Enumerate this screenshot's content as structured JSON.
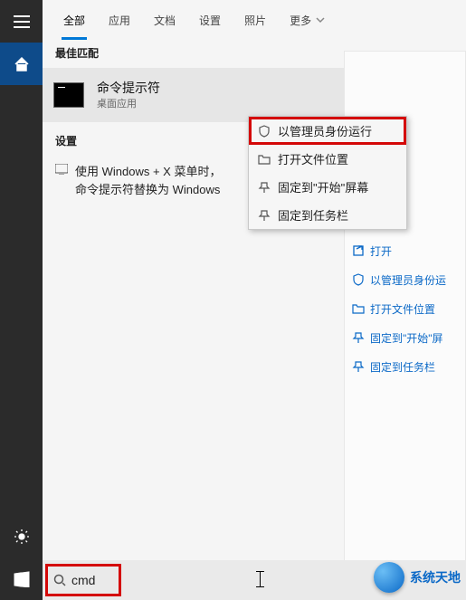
{
  "tabs": {
    "all": "全部",
    "apps": "应用",
    "docs": "文档",
    "settings": "设置",
    "photos": "照片",
    "more": "更多"
  },
  "sections": {
    "best_match": "最佳匹配",
    "settings": "设置"
  },
  "best_match": {
    "title": "命令提示符",
    "subtitle": "桌面应用"
  },
  "settings_result": {
    "line1": "使用 Windows + X 菜单时，",
    "line2": "命令提示符替换为 Windows"
  },
  "context_menu": {
    "run_admin": "以管理员身份运行",
    "open_location": "打开文件位置",
    "pin_start": "固定到\"开始\"屏幕",
    "pin_taskbar": "固定到任务栏"
  },
  "right_panel": {
    "open": "打开",
    "run_admin": "以管理员身份运",
    "open_location": "打开文件位置",
    "pin_start": "固定到\"开始\"屏",
    "pin_taskbar": "固定到任务栏"
  },
  "search": {
    "value": "cmd"
  },
  "brand": "系统天地",
  "colors": {
    "accent": "#0078d7",
    "highlight": "#d40808",
    "link": "#0b69c7"
  }
}
